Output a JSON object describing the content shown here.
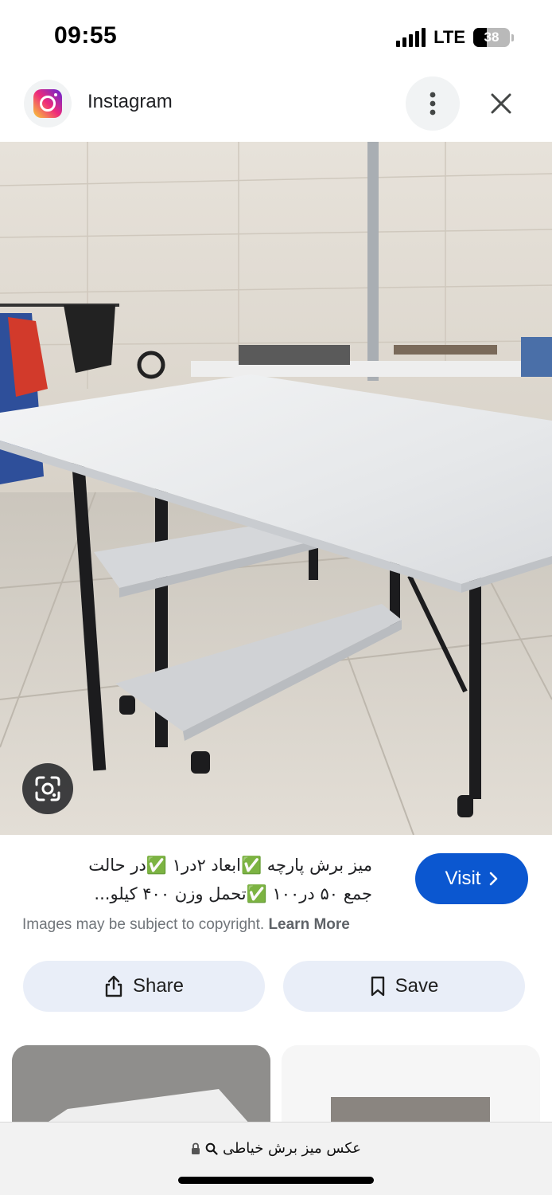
{
  "status_bar": {
    "time": "09:55",
    "network": "LTE",
    "battery": "38",
    "battery_level": 0.38
  },
  "header": {
    "site_name": "Instagram",
    "site_icon": "instagram-logo",
    "more_icon": "more-vert-icon",
    "close_icon": "close-icon"
  },
  "image_viewer": {
    "lens_icon": "google-lens-icon"
  },
  "result": {
    "caption_line1": "میز برش پارچه ✅ابعاد ۲در۱ ✅در حالت",
    "caption_line2": "جمع ۵۰ در۱۰۰ ✅تحمل وزن ۴۰۰ کیلو...",
    "visit_label": "Visit",
    "copyright_text": "Images may be subject to copyright.",
    "learn_more_label": "Learn More"
  },
  "actions": {
    "share_label": "Share",
    "save_label": "Save"
  },
  "bottom_bar": {
    "address_text": "عکس میز برش خیاطی",
    "lock_icon": "lock-icon",
    "search_icon": "search-icon"
  },
  "colors": {
    "visit_button": "#0b57d0",
    "action_button_bg": "#e9eef8",
    "muted_text": "#70757a"
  }
}
